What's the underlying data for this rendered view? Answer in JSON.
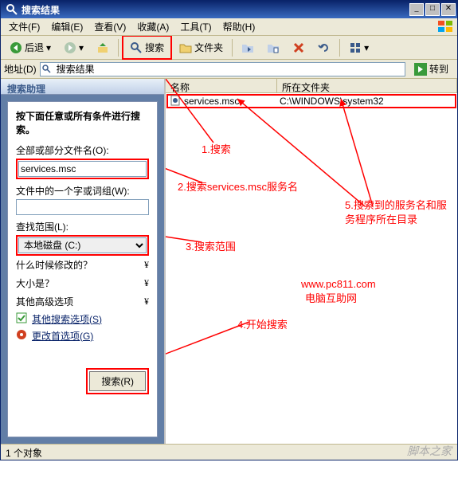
{
  "window": {
    "title": "搜索结果"
  },
  "menu": {
    "file": "文件(F)",
    "edit": "编辑(E)",
    "view": "查看(V)",
    "favorites": "收藏(A)",
    "tools": "工具(T)",
    "help": "帮助(H)"
  },
  "toolbar": {
    "back": "后退",
    "search": "搜索",
    "folders": "文件夹"
  },
  "addressbar": {
    "label": "地址(D)",
    "value": "搜索结果",
    "go": "转到"
  },
  "assistant": {
    "header": "搜索助理",
    "headline": "按下面任意或所有条件进行搜索。",
    "filename_label": "全部或部分文件名(O):",
    "filename_value": "services.msc",
    "word_label": "文件中的一个字或词组(W):",
    "word_value": "",
    "lookin_label": "查找范围(L):",
    "lookin_value": "本地磁盘 (C:)",
    "when_label": "什么时候修改的？",
    "size_label": "大小是？",
    "adv_label": "其他高级选项",
    "other_opts": "其他搜索选项(S)",
    "change_prefs": "更改首选项(G)",
    "search_btn": "搜索(R)"
  },
  "results": {
    "col_name": "名称",
    "col_folder": "所在文件夹",
    "rows": [
      {
        "name": "services.msc",
        "folder": "C:\\WINDOWS\\system32"
      }
    ]
  },
  "annotations": {
    "a1": "1.搜索",
    "a2": "2.搜索services.msc服务名",
    "a3": "3.搜索范围",
    "a4": "4.开始搜索",
    "a5": "5.搜索到的服务名和服务程序所在目录",
    "site1": "www.pc811.com",
    "site2": "电脑互助网"
  },
  "statusbar": {
    "text": "1 个对象"
  },
  "watermark": "脚本之家"
}
